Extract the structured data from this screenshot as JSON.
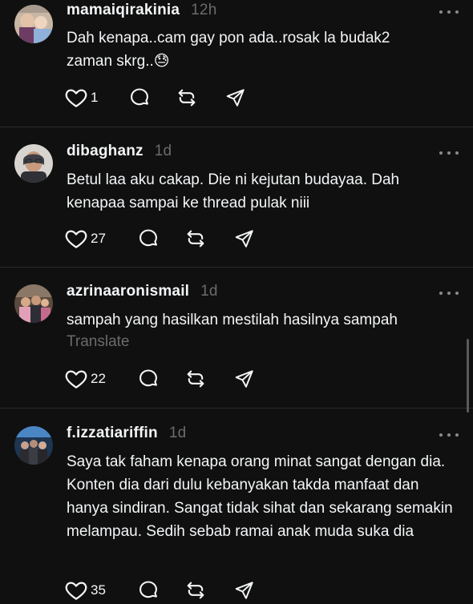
{
  "posts": [
    {
      "username": "mamaiqirakinia",
      "time": "12h",
      "text": "Dah kenapa..cam gay pon ada..rosak la budak2 zaman skrg..😓",
      "likes": "1",
      "translate": ""
    },
    {
      "username": "dibaghanz",
      "time": "1d",
      "text": "Betul laa aku cakap. Die ni kejutan budayaa. Dah kenapaa sampai ke thread pulak niii",
      "likes": "27",
      "translate": ""
    },
    {
      "username": "azrinaaronismail",
      "time": "1d",
      "text": "sampah yang hasilkan mestilah hasilnya sampah",
      "likes": "22",
      "translate": "Translate"
    },
    {
      "username": "f.izzatiariffin",
      "time": "1d",
      "text": "Saya tak faham kenapa orang minat sangat dengan dia. Konten dia dari dulu kebanyakan takda manfaat dan hanya sindiran. Sangat tidak sihat dan sekarang semakin melampau. Sedih sebab ramai anak muda suka dia",
      "likes": "35",
      "translate": ""
    }
  ],
  "icons": {
    "like": "heart-icon",
    "reply": "comment-icon",
    "repost": "repost-icon",
    "share": "send-icon",
    "more": "more-icon"
  }
}
